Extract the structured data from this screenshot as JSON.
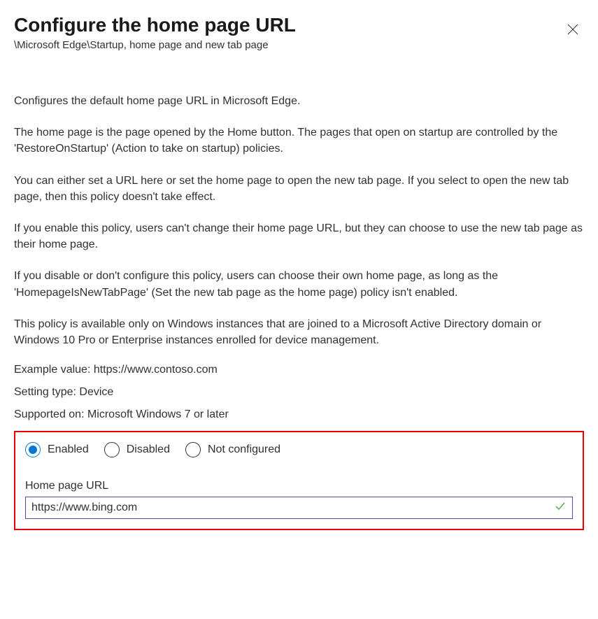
{
  "header": {
    "title": "Configure the home page URL",
    "breadcrumb": "\\Microsoft Edge\\Startup, home page and new tab page"
  },
  "description": {
    "p1": "Configures the default home page URL in Microsoft Edge.",
    "p2": "The home page is the page opened by the Home button. The pages that open on startup are controlled by the 'RestoreOnStartup' (Action to take on startup) policies.",
    "p3": "You can either set a URL here or set the home page to open the new tab page. If you select to open the new tab page, then this policy doesn't take effect.",
    "p4": "If you enable this policy, users can't change their home page URL, but they can choose to use the new tab page as their home page.",
    "p5": "If you disable or don't configure this policy, users can choose their own home page, as long as the 'HomepageIsNewTabPage' (Set the new tab page as the home page) policy isn't enabled.",
    "p6": "This policy is available only on Windows instances that are joined to a Microsoft Active Directory domain or Windows 10 Pro or Enterprise instances enrolled for device management."
  },
  "meta": {
    "example": "Example value: https://www.contoso.com",
    "setting_type": "Setting type: Device",
    "supported_on": "Supported on: Microsoft Windows 7 or later"
  },
  "config": {
    "radios": {
      "enabled": "Enabled",
      "disabled": "Disabled",
      "not_configured": "Not configured"
    },
    "field_label": "Home page URL",
    "field_value": "https://www.bing.com"
  }
}
